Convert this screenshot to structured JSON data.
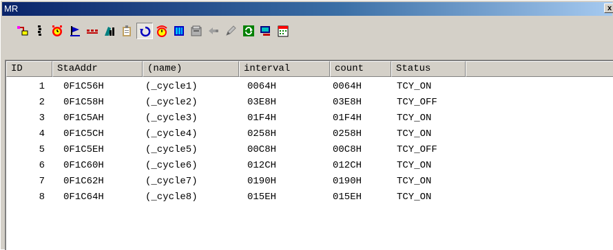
{
  "window": {
    "title": "MR",
    "close_label": "x"
  },
  "toolbar": {
    "buttons": [
      {
        "icon": "hierarchy-icon"
      },
      {
        "icon": "vertical-dots-icon"
      },
      {
        "icon": "alarm-clock-icon"
      },
      {
        "icon": "flag-icon"
      },
      {
        "icon": "ellipsis-icon"
      },
      {
        "icon": "bar-chart-icon"
      },
      {
        "icon": "clipboard-icon"
      },
      {
        "icon": "cycle-handler-icon",
        "pressed": true
      },
      {
        "icon": "signal-clock-icon"
      },
      {
        "icon": "memory-block-icon"
      },
      {
        "icon": "mailbox-icon"
      },
      {
        "icon": "arrow-left-icon"
      },
      {
        "icon": "pencil-icon"
      },
      {
        "icon": "refresh-icon"
      },
      {
        "icon": "monitor-icon"
      },
      {
        "icon": "calendar-icon"
      }
    ]
  },
  "table": {
    "columns": [
      "ID",
      "StaAddr",
      "(name)",
      "interval",
      "count",
      "Status"
    ],
    "rows": [
      {
        "id": "1",
        "staaddr": "0F1C56H",
        "name": "(_cycle1)",
        "interval": "0064H",
        "count": "0064H",
        "status": "TCY_ON"
      },
      {
        "id": "2",
        "staaddr": "0F1C58H",
        "name": "(_cycle2)",
        "interval": "03E8H",
        "count": "03E8H",
        "status": "TCY_OFF"
      },
      {
        "id": "3",
        "staaddr": "0F1C5AH",
        "name": "(_cycle3)",
        "interval": "01F4H",
        "count": "01F4H",
        "status": "TCY_ON"
      },
      {
        "id": "4",
        "staaddr": "0F1C5CH",
        "name": "(_cycle4)",
        "interval": "0258H",
        "count": "0258H",
        "status": "TCY_ON"
      },
      {
        "id": "5",
        "staaddr": "0F1C5EH",
        "name": "(_cycle5)",
        "interval": "00C8H",
        "count": "00C8H",
        "status": "TCY_OFF"
      },
      {
        "id": "6",
        "staaddr": "0F1C60H",
        "name": "(_cycle6)",
        "interval": "012CH",
        "count": "012CH",
        "status": "TCY_ON"
      },
      {
        "id": "7",
        "staaddr": "0F1C62H",
        "name": "(_cycle7)",
        "interval": "0190H",
        "count": "0190H",
        "status": "TCY_ON"
      },
      {
        "id": "8",
        "staaddr": "0F1C64H",
        "name": "(_cycle8)",
        "interval": "015EH",
        "count": "015EH",
        "status": "TCY_ON"
      }
    ]
  }
}
